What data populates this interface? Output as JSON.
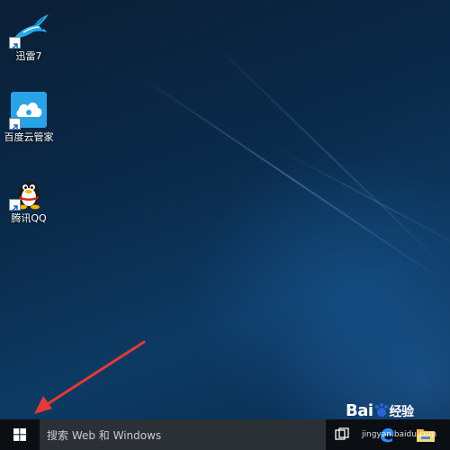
{
  "desktop": {
    "icons": [
      {
        "label": "迅雷7"
      },
      {
        "label": "百度云管家"
      },
      {
        "label": "腾讯QQ"
      }
    ]
  },
  "taskbar": {
    "search_placeholder": "搜索 Web 和 Windows"
  },
  "watermark": {
    "brand": "Bai",
    "brand_cn": "经验",
    "url": "jingyan.baidu.com"
  },
  "colors": {
    "taskbar": "#0b0f14",
    "search_box": "#2b2f36",
    "arrow": "#e53935",
    "baidu_tile": "#2aa3e6"
  },
  "icon_names": [
    "xunlei-bird-icon",
    "baidu-cloud-icon",
    "qq-penguin-icon",
    "windows-start-icon",
    "task-view-icon",
    "edge-icon",
    "file-explorer-icon"
  ]
}
